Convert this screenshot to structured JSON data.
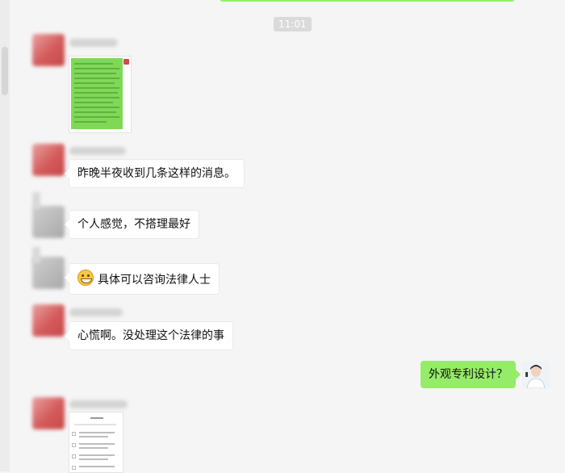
{
  "chat": {
    "timestamp": "11:01",
    "messages": [
      {
        "id": "m1",
        "side": "left",
        "type": "image",
        "description_icon": "chat-screenshot-image"
      },
      {
        "id": "m2",
        "side": "left",
        "type": "text",
        "text": "昨晚半夜收到几条这样的消息。"
      },
      {
        "id": "m3",
        "side": "left",
        "type": "text",
        "text": "个人感觉，不搭理最好"
      },
      {
        "id": "m4",
        "side": "left",
        "type": "text",
        "emoji": "grin-emoji",
        "text": "具体可以咨询法律人士"
      },
      {
        "id": "m5",
        "side": "left",
        "type": "text",
        "text": "心慌啊。没处理这个法律的事"
      },
      {
        "id": "m6",
        "side": "right",
        "type": "text",
        "text": "外观专利设计？"
      },
      {
        "id": "m7",
        "side": "left",
        "type": "image",
        "description_icon": "phone-screenshot-image"
      }
    ]
  },
  "colors": {
    "background": "#f5f5f5",
    "my_bubble": "#95ec69",
    "other_bubble": "#ffffff",
    "timestamp_bg": "#dadada"
  }
}
